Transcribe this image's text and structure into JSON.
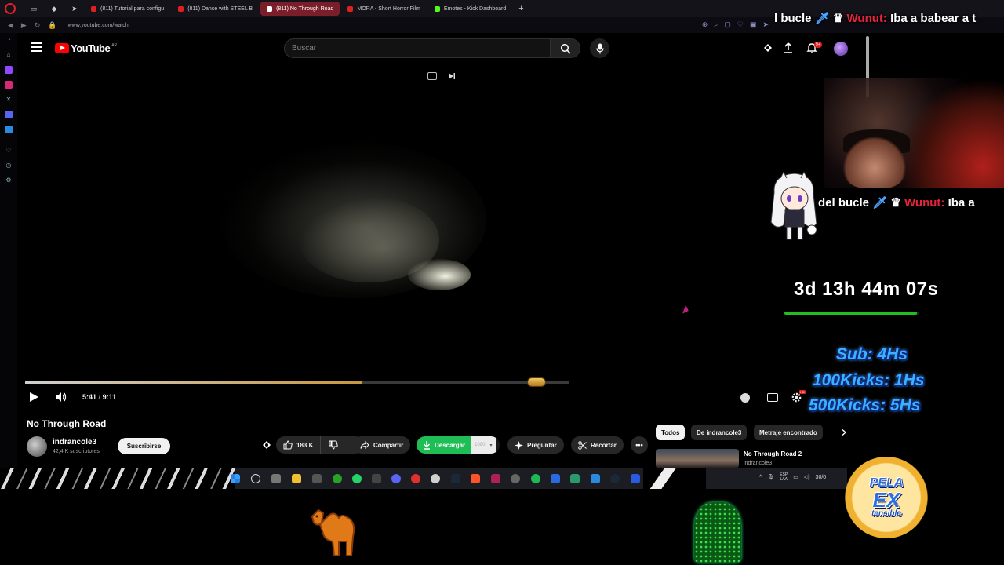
{
  "browser": {
    "tabs": [
      {
        "label": "(811) Tutorial para configu",
        "favicon_color": "#e02020",
        "active": false
      },
      {
        "label": "(811) Dance with STEEL B",
        "favicon_color": "#e02020",
        "active": false
      },
      {
        "label": "(811) No Through Road",
        "favicon_color": "#e02020",
        "active": true
      },
      {
        "label": "MORA - Short Horror Film",
        "favicon_color": "#e02020",
        "active": false
      },
      {
        "label": "Emotes - Kick Dashboard",
        "favicon_color": "#53fc18",
        "active": false
      }
    ],
    "new_tab_symbol": "+",
    "url": "www.youtube.com/watch"
  },
  "youtube": {
    "logo_text": "YouTube",
    "country_code": "AR",
    "search_placeholder": "Buscar",
    "notifications_badge": "9+"
  },
  "player": {
    "current_time": "5:41",
    "separator": "/",
    "duration": "9:11",
    "progress_fraction": 0.619
  },
  "video": {
    "title": "No Through Road",
    "channel": "indrancole3",
    "subscribers": "42,4 K suscriptores",
    "subscribe_label": "Suscribirse",
    "likes": "183 K",
    "share_label": "Compartir",
    "download_label": "Descargar",
    "quality_label": "1080",
    "ask_label": "Preguntar",
    "clip_label": "Recortar",
    "more_label": "•••"
  },
  "sidebar_right": {
    "chips": [
      "Todos",
      "De indrancole3",
      "Metraje encontrado"
    ],
    "recommended": {
      "title": "No Through Road 2",
      "channel": "indrancole3"
    }
  },
  "tray": {
    "lang_line1": "ESP",
    "lang_line2": "LAA",
    "date": "30/0"
  },
  "overlay": {
    "chat_top": {
      "pre": "l bucle",
      "user": "Wunut:",
      "msg": "Iba a babear a t"
    },
    "chat_mid": {
      "pre": "del bucle",
      "user": "Wunut:",
      "msg": "Iba a"
    },
    "countdown": "3d 13h 44m 07s",
    "countdown_fraction": 0.98,
    "goals": [
      "Sub: 4Hs",
      "100Kicks: 1Hs",
      "500Kicks: 5Hs"
    ],
    "logo": {
      "line1": "PELA",
      "line2": "EX",
      "line3": "tensible"
    }
  },
  "colors": {
    "accent_red": "#ff0000",
    "download_green": "#1fbd55",
    "chat_user": "#e8243a",
    "goal_blue": "#3ab0ff",
    "countdown_green": "#21c021"
  }
}
